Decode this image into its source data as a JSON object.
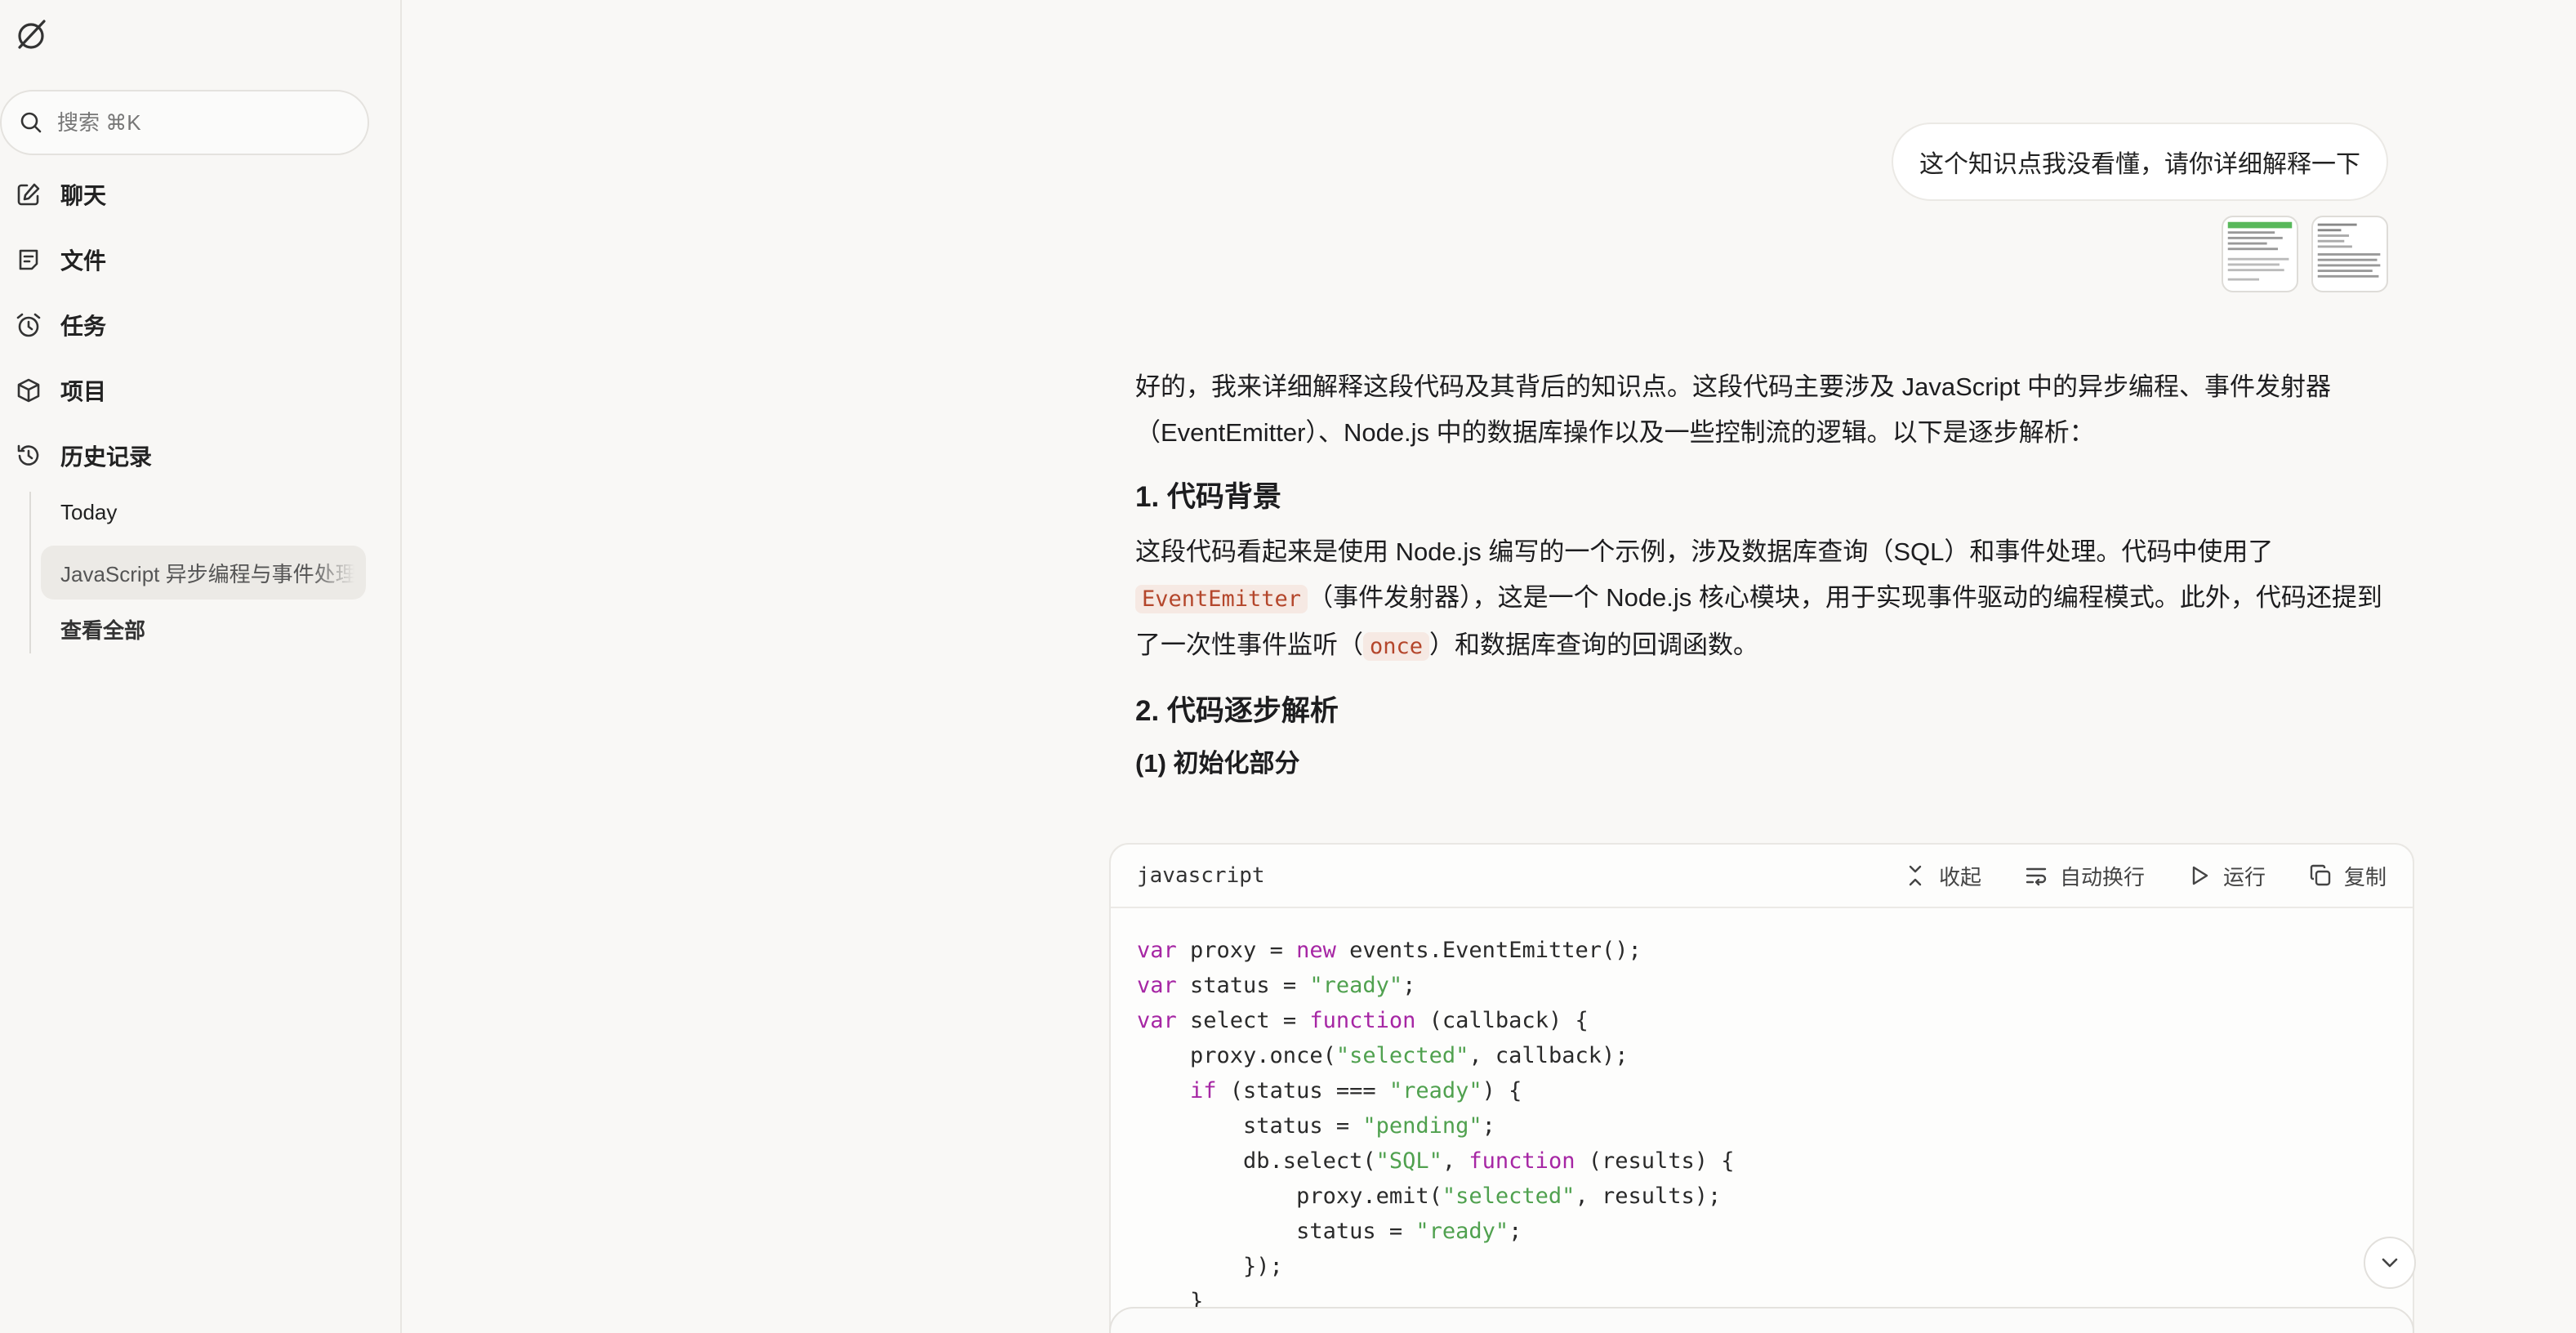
{
  "sidebar": {
    "search_placeholder": "搜索 ⌘K",
    "items": [
      {
        "label": "聊天"
      },
      {
        "label": "文件"
      },
      {
        "label": "任务"
      },
      {
        "label": "项目"
      },
      {
        "label": "历史记录"
      }
    ],
    "history": {
      "group_label": "Today",
      "active_item": "JavaScript 异步编程与事件处理",
      "view_all": "查看全部"
    }
  },
  "chat": {
    "user_message": "这个知识点我没看懂，请你详细解释一下",
    "reply": {
      "intro": "好的，我来详细解释这段代码及其背后的知识点。这段代码主要涉及 JavaScript 中的异步编程、事件发射器（EventEmitter）、Node.js 中的数据库操作以及一些控制流的逻辑。以下是逐步解析：",
      "section1_title": "1. 代码背景",
      "section1_p_before": "这段代码看起来是使用 Node.js 编写的一个示例，涉及数据库查询（SQL）和事件处理。代码中使用了",
      "section1_code1": "EventEmitter",
      "section1_p_middle": "（事件发射器），这是一个 Node.js 核心模块，用于实现事件驱动的编程模式。此外，代码还提到了一次性事件监听（",
      "section1_code2": "once",
      "section1_p_after": "）和数据库查询的回调函数。",
      "section2_title": "2. 代码逐步解析",
      "subsection_title": "(1) 初始化部分"
    }
  },
  "code_block": {
    "language": "javascript",
    "collapse_label": "收起",
    "wrap_label": "自动换行",
    "run_label": "运行",
    "copy_label": "复制"
  }
}
